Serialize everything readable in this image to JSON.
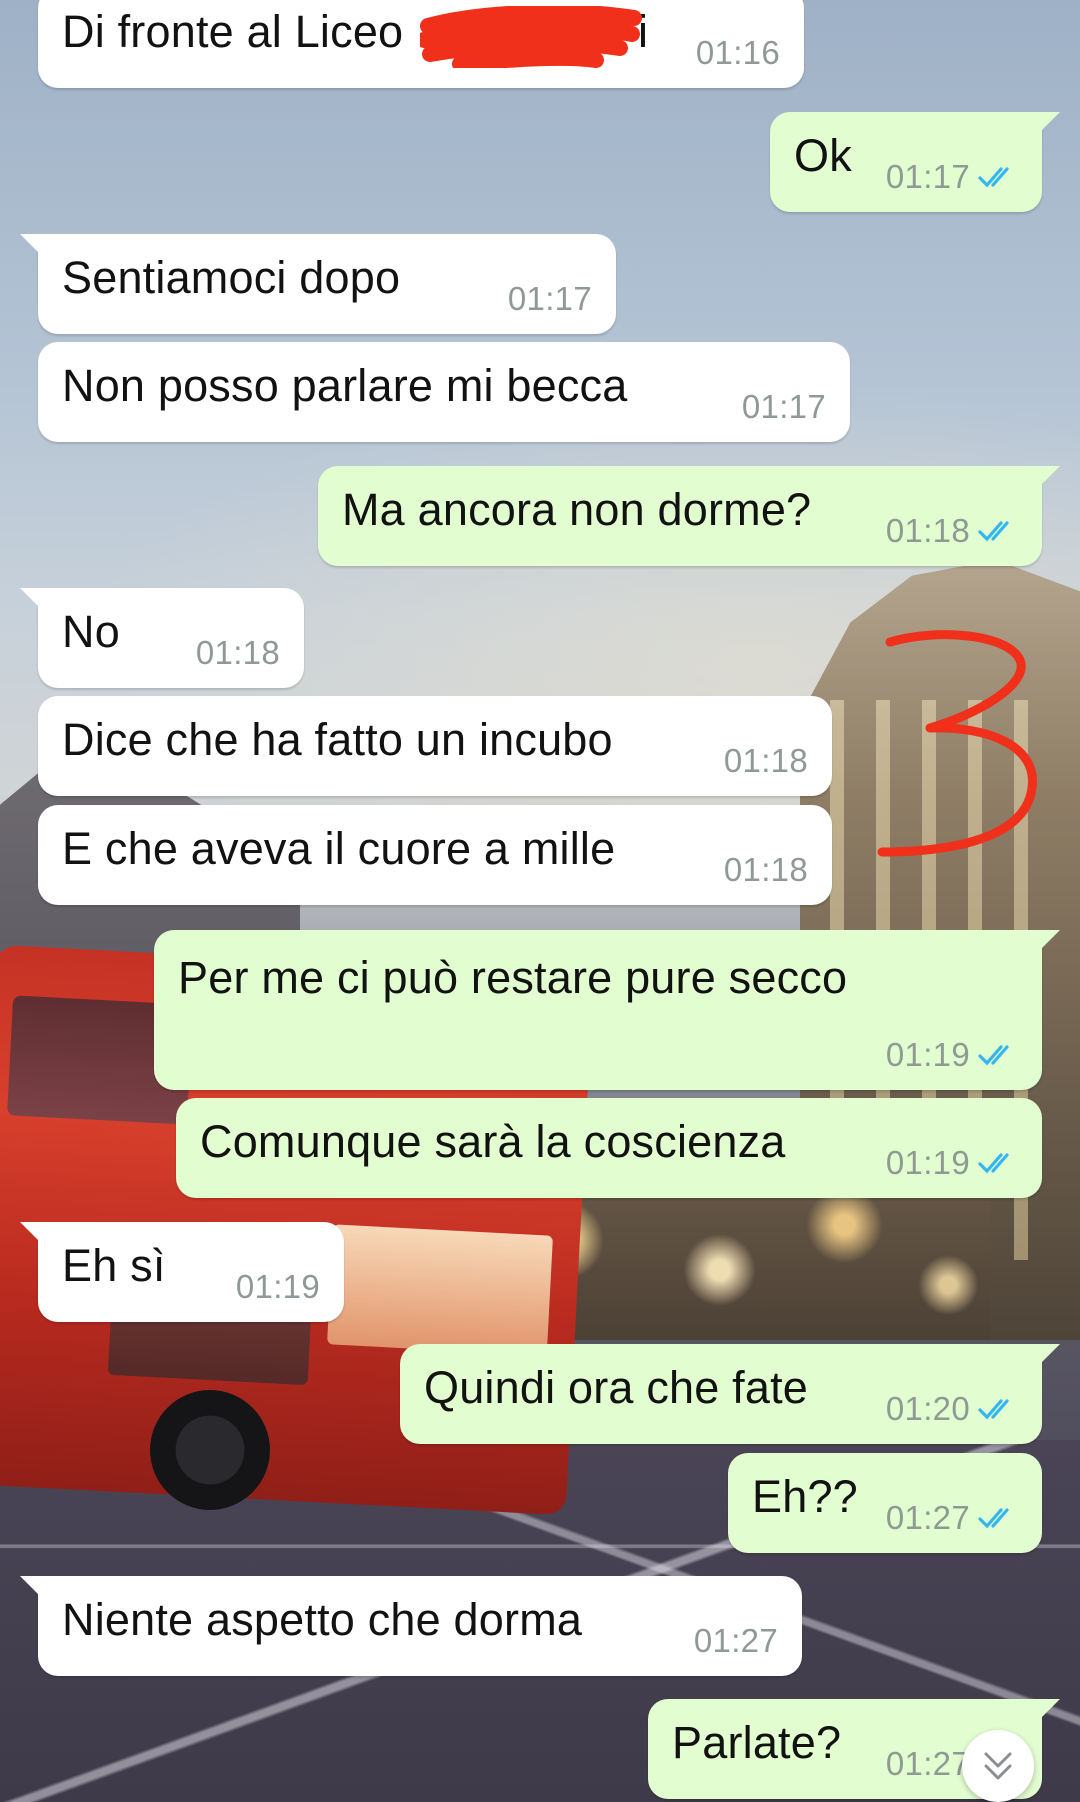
{
  "colors": {
    "incoming_bubble": "#ffffff",
    "outgoing_bubble": "#e2fdd0",
    "timestamp": "#8f9a94",
    "read_ticks": "#34b7f1",
    "marker_red": "#f0301a"
  },
  "icons": {
    "read_receipt": "double-check-icon",
    "scroll_down": "chevron-double-down-icon"
  },
  "messages": [
    {
      "dir": "in",
      "text": "Di fronte al Liceo",
      "trailing_text": "i",
      "time": "01:16"
    },
    {
      "dir": "out",
      "text": "Ok",
      "time": "01:17"
    },
    {
      "dir": "in",
      "text": "Sentiamoci dopo",
      "time": "01:17"
    },
    {
      "dir": "in",
      "text": "Non posso parlare mi becca",
      "time": "01:17"
    },
    {
      "dir": "out",
      "text": "Ma ancora non dorme?",
      "time": "01:18"
    },
    {
      "dir": "in",
      "text": "No",
      "time": "01:18"
    },
    {
      "dir": "in",
      "text": "Dice che ha fatto un incubo",
      "time": "01:18"
    },
    {
      "dir": "in",
      "text": "E che aveva il cuore a mille",
      "time": "01:18"
    },
    {
      "dir": "out",
      "text": "Per me ci può restare pure secco",
      "time": "01:19"
    },
    {
      "dir": "out",
      "text": "Comunque sarà la coscienza",
      "time": "01:19"
    },
    {
      "dir": "in",
      "text": "Eh sì",
      "time": "01:19"
    },
    {
      "dir": "out",
      "text": "Quindi ora che fate",
      "time": "01:20"
    },
    {
      "dir": "out",
      "text": "Eh??",
      "time": "01:27"
    },
    {
      "dir": "in",
      "text": "Niente aspetto che dorma",
      "time": "01:27"
    },
    {
      "dir": "out",
      "text": "Parlate?",
      "time": "01:27"
    }
  ]
}
